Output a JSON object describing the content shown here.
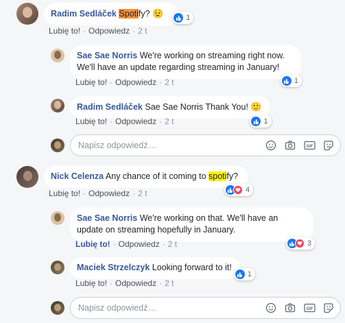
{
  "actions": {
    "like": "Lubię to!",
    "reply": "Odpowiedz",
    "separator": "·"
  },
  "composer": {
    "placeholder": "Napisz odpowiedź…"
  },
  "threads": [
    {
      "comment": {
        "author": "Radim Sedláček",
        "text_before": "",
        "highlight": "Spoti",
        "text_after": "fy?",
        "emoji": "😟",
        "reaction_count": "1",
        "time": "2 t"
      },
      "replies": [
        {
          "author": "Sae Sae Norris",
          "text": "We're working on streaming right now. We'll have an update regarding streaming in January!",
          "reaction_count": "1",
          "time": "2 t"
        },
        {
          "author": "Radim Sedláček",
          "text": "Sae Sae Norris Thank You!",
          "emoji": "🙂",
          "reaction_count": "1",
          "time": "2 t"
        }
      ]
    },
    {
      "comment": {
        "author": "Nick Celenza",
        "text_before": "Any chance of it coming to ",
        "highlight": "spoti",
        "text_after": "fy?",
        "reaction_count": "4",
        "time": "2 t"
      },
      "replies": [
        {
          "author": "Sae Sae Norris",
          "text": "We're working on that. We'll have an update on streaming hopefully in January.",
          "reaction_count": "3",
          "time": "2 t",
          "liked": true
        },
        {
          "author": "Maciek Strzelczyk",
          "text": "Looking forward to it!",
          "reaction_count": "1",
          "time": "2 t"
        }
      ]
    }
  ],
  "colors": {
    "link": "#385898",
    "like": "#1877f2",
    "love": "#f33e58",
    "highlight_orange": "#f7923b",
    "highlight_yellow": "#fff200"
  }
}
